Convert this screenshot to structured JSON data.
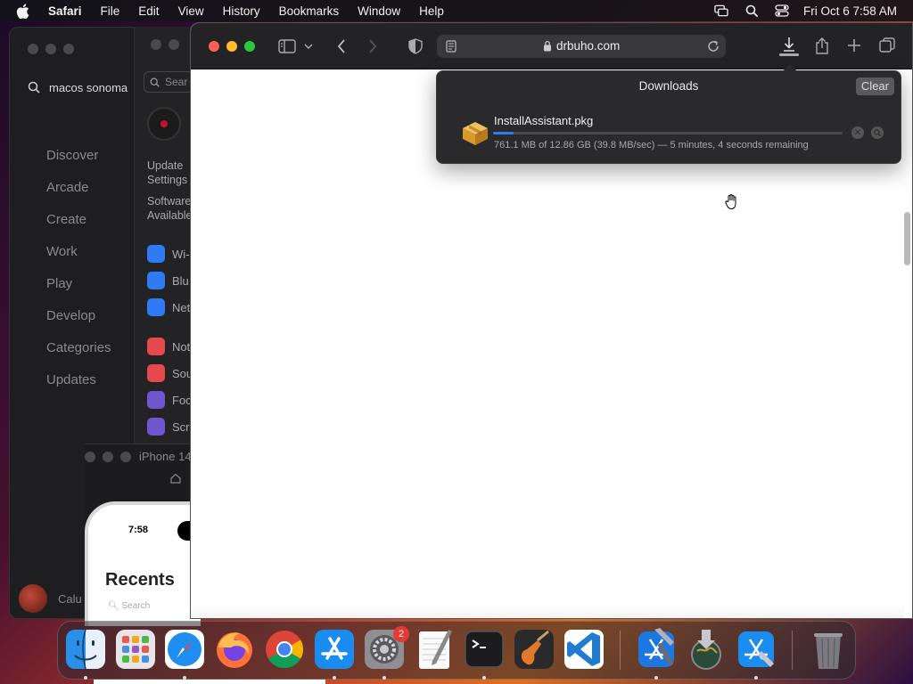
{
  "menubar": {
    "app_name": "Safari",
    "items": [
      "File",
      "Edit",
      "View",
      "History",
      "Bookmarks",
      "Window",
      "Help"
    ],
    "clock": "Fri Oct 6  7:58 AM"
  },
  "appstore": {
    "search_value": "macos sonoma",
    "nav": [
      "Discover",
      "Arcade",
      "Create",
      "Work",
      "Play",
      "Develop",
      "Categories",
      "Updates"
    ],
    "user_name": "Calu"
  },
  "settings": {
    "search_placeholder": "Sear",
    "update_label_1": "Update",
    "update_label_2": "Settings",
    "software_label_1": "Software",
    "software_label_2": "Available",
    "items": [
      {
        "label": "Wi-",
        "color": "#2f7bf5"
      },
      {
        "label": "Blu",
        "color": "#2f7bf5"
      },
      {
        "label": "Net",
        "color": "#2f7bf5"
      },
      {
        "label": "Not",
        "color": "#e5484d"
      },
      {
        "label": "Sou",
        "color": "#e5484d"
      },
      {
        "label": "Foc",
        "color": "#6e56cf"
      },
      {
        "label": "Scr",
        "color": "#6e56cf"
      }
    ]
  },
  "simulator": {
    "title": "iPhone 14",
    "phone_time": "7:58",
    "screen_title": "Recents",
    "screen_search": "Search"
  },
  "safari": {
    "url_domain": "drbuho.com"
  },
  "downloads": {
    "title": "Downloads",
    "clear_label": "Clear",
    "file_name": "InstallAssistant.pkg",
    "status": "761.1 MB of 12.86 GB (39.8 MB/sec) — 5 minutes, 4 seconds remaining",
    "progress_fraction": 0.059
  },
  "dock": {
    "settings_badge": "2",
    "apps": [
      "finder-icon",
      "launchpad-icon",
      "safari-icon",
      "firefox-icon",
      "chrome-icon",
      "app-store-icon",
      "system-settings-icon",
      "textedit-icon",
      "terminal-icon",
      "garageband-icon",
      "vscode-icon",
      "xcode-icon",
      "installer-icon",
      "simulator-icon",
      "trash-icon"
    ]
  },
  "colors": {
    "accent": "#2f7bf5",
    "close": "#ff5f57",
    "minimize": "#febc2e",
    "zoom": "#28c840"
  }
}
